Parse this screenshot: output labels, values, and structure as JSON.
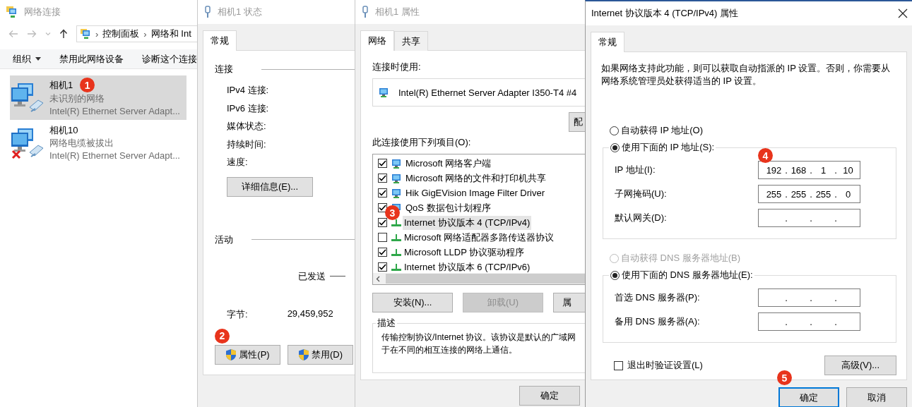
{
  "explorer": {
    "title": "网络连接",
    "address": {
      "separator": "›",
      "segments": [
        "控制面板",
        "网络和 Int"
      ]
    },
    "toolbar": [
      {
        "label": "组织",
        "kind": "menu"
      },
      {
        "label": "禁用此网络设备",
        "kind": "command"
      },
      {
        "label": "诊断这个连接",
        "kind": "command"
      }
    ],
    "items": [
      {
        "name": "相机1",
        "status": "未识别的网络",
        "adapter": "Intel(R) Ethernet Server Adapt...",
        "selected": true,
        "disconnected": false,
        "marker": "1"
      },
      {
        "name": "相机10",
        "status": "网络电缆被拔出",
        "adapter": "Intel(R) Ethernet Server Adapt...",
        "selected": false,
        "disconnected": true
      }
    ]
  },
  "status_window": {
    "title": "相机1 状态",
    "tabs": [
      {
        "label": "常规",
        "selected": true
      }
    ],
    "connection_heading": "连接",
    "connection_labels": [
      "IPv4 连接:",
      "IPv6 连接:",
      "媒体状态:",
      "持续时间:",
      "速度:"
    ],
    "details_button": "详细信息(E)...",
    "activity_heading": "活动",
    "sent_label": "已发送",
    "bytes_label": "字节:",
    "bytes_value": "29,459,952",
    "buttons": [
      {
        "label": "属性(P)",
        "marker": "2"
      },
      {
        "label": "禁用(D)"
      }
    ]
  },
  "properties_window": {
    "title": "相机1 属性",
    "tabs": [
      {
        "label": "网络",
        "selected": true
      },
      {
        "label": "共享",
        "selected": false
      }
    ],
    "connect_using_label": "连接时使用:",
    "adapter": "Intel(R) Ethernet Server Adapter I350-T4 #4",
    "configure_button": "配",
    "items_label": "此连接使用下列项目(O):",
    "components": [
      {
        "label": "Microsoft 网络客户端",
        "checked": true,
        "selected": false,
        "kind": "client"
      },
      {
        "label": "Microsoft 网络的文件和打印机共享",
        "checked": true,
        "selected": false,
        "kind": "service"
      },
      {
        "label": "Hik GigEVision Image Filter Driver",
        "checked": true,
        "selected": false,
        "kind": "service"
      },
      {
        "label": "QoS 数据包计划程序",
        "checked": true,
        "selected": false,
        "kind": "service"
      },
      {
        "label": "Internet 协议版本 4 (TCP/IPv4)",
        "checked": true,
        "selected": true,
        "kind": "protocol",
        "marker": "3"
      },
      {
        "label": "Microsoft 网络适配器多路传送器协议",
        "checked": false,
        "selected": false,
        "kind": "protocol"
      },
      {
        "label": "Microsoft LLDP 协议驱动程序",
        "checked": true,
        "selected": false,
        "kind": "protocol"
      },
      {
        "label": "Internet 协议版本 6 (TCP/IPv6)",
        "checked": true,
        "selected": false,
        "kind": "protocol"
      }
    ],
    "buttons": [
      {
        "label": "安装(N)...",
        "disabled": false
      },
      {
        "label": "卸载(U)",
        "disabled": true
      },
      {
        "label": "属",
        "disabled": false
      }
    ],
    "description": {
      "heading": "描述",
      "lines": [
        "传输控制协议/Internet 协议。该协议是默认的广域网",
        "于在不同的相互连接的网络上通信。"
      ]
    },
    "ok_button": "确定"
  },
  "ipv4_window": {
    "title": "Internet 协议版本 4 (TCP/IPv4) 属性",
    "tabs": [
      {
        "label": "常规",
        "selected": true
      }
    ],
    "intro": "如果网络支持此功能，则可以获取自动指派的 IP 设置。否则，你需要从网络系统管理员处获得适当的 IP 设置。",
    "ip_auto": {
      "label": "自动获得 IP 地址(O)",
      "selected": false,
      "disabled": false
    },
    "ip_manual": {
      "label": "使用下面的 IP 地址(S):",
      "selected": true,
      "disabled": false
    },
    "ip_fields": [
      {
        "label": "IP 地址(I):",
        "parts": [
          "192",
          ".",
          "168",
          ".",
          "1",
          ".",
          "10"
        ],
        "marker": "4"
      },
      {
        "label": "子网掩码(U):",
        "parts": [
          "255",
          ".",
          "255",
          ".",
          "255",
          ".",
          "0"
        ]
      },
      {
        "label": "默认网关(D):",
        "parts": [
          ".",
          ".",
          "."
        ]
      }
    ],
    "dns_auto": {
      "label": "自动获得 DNS 服务器地址(B)",
      "selected": false,
      "disabled": true
    },
    "dns_manual": {
      "label": "使用下面的 DNS 服务器地址(E):",
      "selected": true,
      "disabled": false
    },
    "dns_fields": [
      {
        "label": "首选 DNS 服务器(P):",
        "parts": [
          ".",
          ".",
          "."
        ]
      },
      {
        "label": "备用 DNS 服务器(A):",
        "parts": [
          ".",
          ".",
          "."
        ]
      }
    ],
    "validate": {
      "label": "退出时验证设置(L)",
      "checked": false
    },
    "advanced_button": "高级(V)...",
    "ok_button": {
      "label": "确定",
      "focused": true,
      "marker": "5"
    },
    "cancel_button": "取消"
  }
}
